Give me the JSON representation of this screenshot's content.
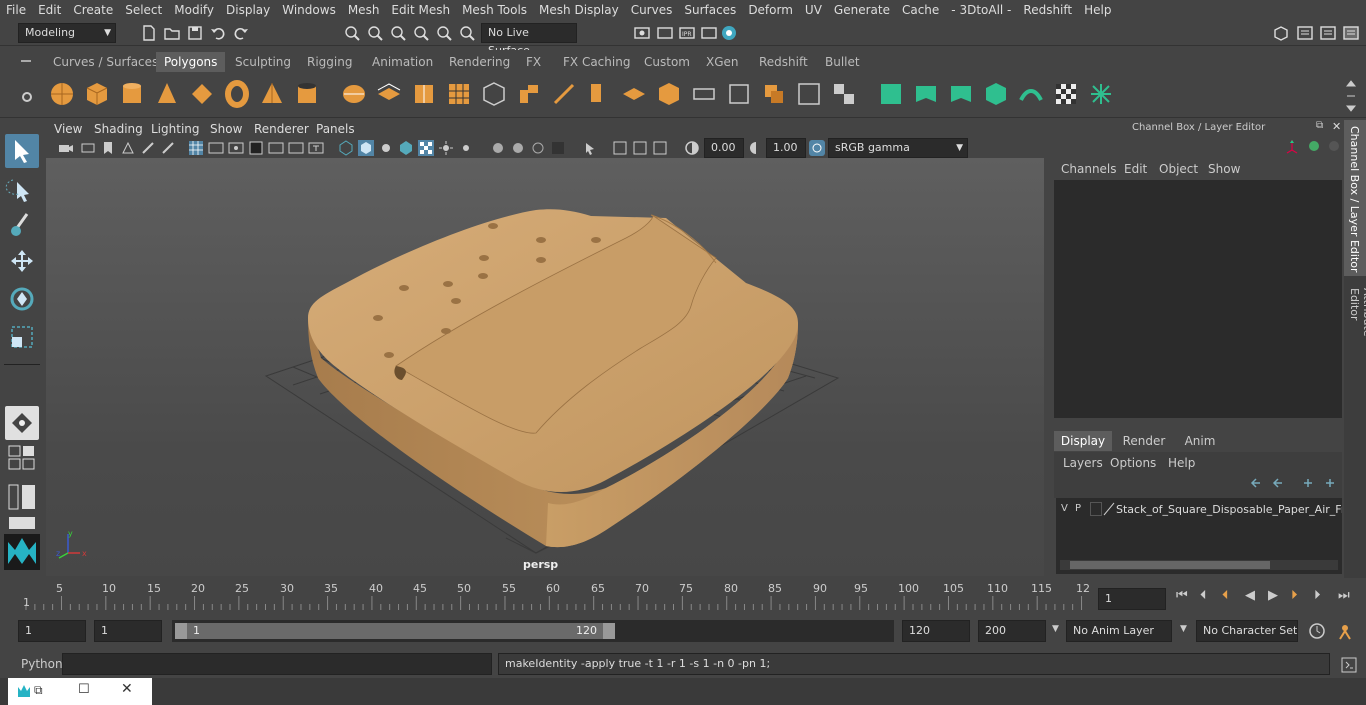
{
  "menu": {
    "items": [
      "File",
      "Edit",
      "Create",
      "Select",
      "Modify",
      "Display",
      "Windows",
      "Mesh",
      "Edit Mesh",
      "Mesh Tools",
      "Mesh Display",
      "Curves",
      "Surfaces",
      "Deform",
      "UV",
      "Generate",
      "Cache",
      "- 3DtoAll -",
      "Redshift",
      "Help"
    ]
  },
  "status": {
    "mode": "Modeling",
    "live_surface": "No Live Surface"
  },
  "shelf": {
    "tabs": [
      "Curves / Surfaces",
      "Polygons",
      "Sculpting",
      "Rigging",
      "Animation",
      "Rendering",
      "FX",
      "FX Caching",
      "Custom",
      "XGen",
      "Redshift",
      "Bullet"
    ],
    "active": "Polygons"
  },
  "viewport": {
    "menus": [
      "View",
      "Shading",
      "Lighting",
      "Show",
      "Renderer",
      "Panels"
    ],
    "near": "0.00",
    "far": "1.00",
    "color_space": "sRGB gamma",
    "camera": "persp"
  },
  "channel_box": {
    "title": "Channel Box / Layer Editor",
    "menus": [
      "Channels",
      "Edit",
      "Object",
      "Show"
    ],
    "tabs": [
      "Display",
      "Render",
      "Anim"
    ],
    "active_tab": "Display",
    "layer_menus": [
      "Layers",
      "Options",
      "Help"
    ],
    "layer": {
      "v": "V",
      "p": "P",
      "name": "Stack_of_Square_Disposable_Paper_Air_Frie"
    }
  },
  "side_tabs": [
    "Channel Box / Layer Editor",
    "Attribute Editor"
  ],
  "timeline": {
    "ticks": [
      "5",
      "10",
      "15",
      "20",
      "25",
      "30",
      "35",
      "40",
      "45",
      "50",
      "55",
      "60",
      "65",
      "70",
      "75",
      "80",
      "85",
      "90",
      "95",
      "100",
      "105",
      "110",
      "115",
      "12"
    ],
    "start_label": "1",
    "current_frame": "1"
  },
  "range": {
    "start": "1",
    "current": "1",
    "slider_start": "1",
    "slider_end": "120",
    "end": "120",
    "max": "200",
    "anim_layer": "No Anim Layer",
    "char_set": "No Character Set"
  },
  "command": {
    "lang": "Python",
    "output": "makeIdentity -apply true -t 1 -r 1 -s 1 -n 0 -pn 1;"
  },
  "colors": {
    "accent": "#5285a6",
    "model": "#c49a68",
    "bg": "#444444"
  }
}
